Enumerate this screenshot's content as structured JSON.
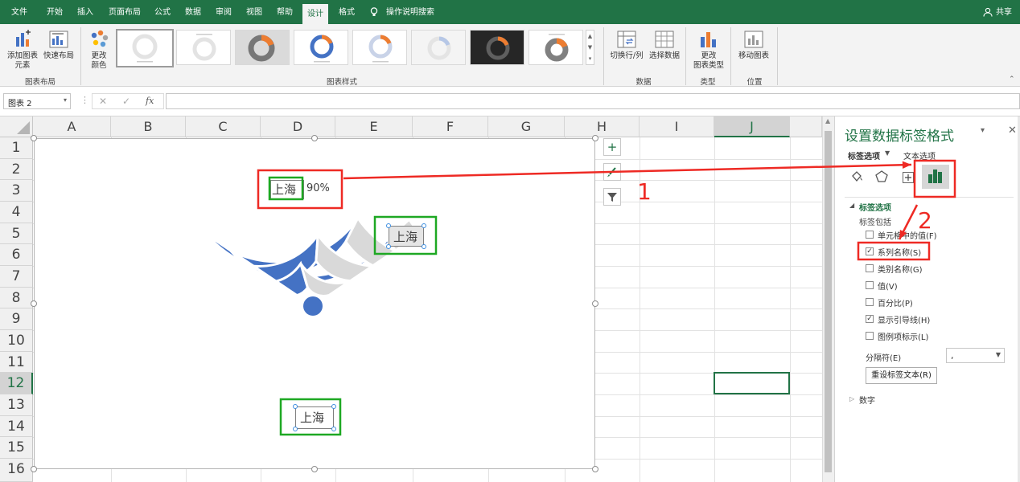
{
  "ribbon_tabs": [
    "文件",
    "开始",
    "插入",
    "页面布局",
    "公式",
    "数据",
    "审阅",
    "视图",
    "帮助",
    "设计",
    "格式"
  ],
  "active_tab": "设计",
  "tell_me": "操作说明搜索",
  "share": "共享",
  "ribbon": {
    "add_element": "添加图表\n元素",
    "quick_layout": "快速布局",
    "group_layout": "图表布局",
    "change_color": "更改\n颜色",
    "group_styles": "图表样式",
    "switch_rowcol": "切换行/列",
    "select_data": "选择数据",
    "group_data": "数据",
    "change_type": "更改\n图表类型",
    "group_type": "类型",
    "move_chart": "移动图表",
    "group_location": "位置"
  },
  "formula_bar": {
    "name_box": "图表 2",
    "cancel": "✕",
    "enter": "✓",
    "fx": "fx",
    "formula": ""
  },
  "columns": [
    "A",
    "B",
    "C",
    "D",
    "E",
    "F",
    "G",
    "H",
    "I",
    "J"
  ],
  "rows": [
    "1",
    "2",
    "3",
    "4",
    "5",
    "6",
    "7",
    "8",
    "9",
    "10",
    "11",
    "12",
    "13",
    "14",
    "15",
    "16"
  ],
  "selected_column": "J",
  "selected_row": "12",
  "chart": {
    "label_top_name": "上海",
    "label_top_pct": "90%",
    "label_right": "上海",
    "label_bottom": "上海",
    "blue": "#4472c4",
    "gray": "#d9d9d9"
  },
  "annotations": {
    "num1": "1",
    "num2": "2",
    "red": "#ee2a24",
    "green": "#1ea823"
  },
  "pane": {
    "title": "设置数据标签格式",
    "tab_label_options": "标签选项",
    "tab_text_options": "文本选项",
    "section_label_options": "标签选项",
    "label_contains": "标签包括",
    "options": [
      {
        "label": "单元格中的值(F)",
        "checked": false
      },
      {
        "label": "系列名称(S)",
        "checked": true
      },
      {
        "label": "类别名称(G)",
        "checked": false
      },
      {
        "label": "值(V)",
        "checked": false
      },
      {
        "label": "百分比(P)",
        "checked": false
      },
      {
        "label": "显示引导线(H)",
        "checked": true
      },
      {
        "label": "图例项标示(L)",
        "checked": false
      }
    ],
    "separator_label": "分隔符(E)",
    "separator_value": ",",
    "reset_button": "重设标签文本(R)",
    "number_section": "数字"
  }
}
